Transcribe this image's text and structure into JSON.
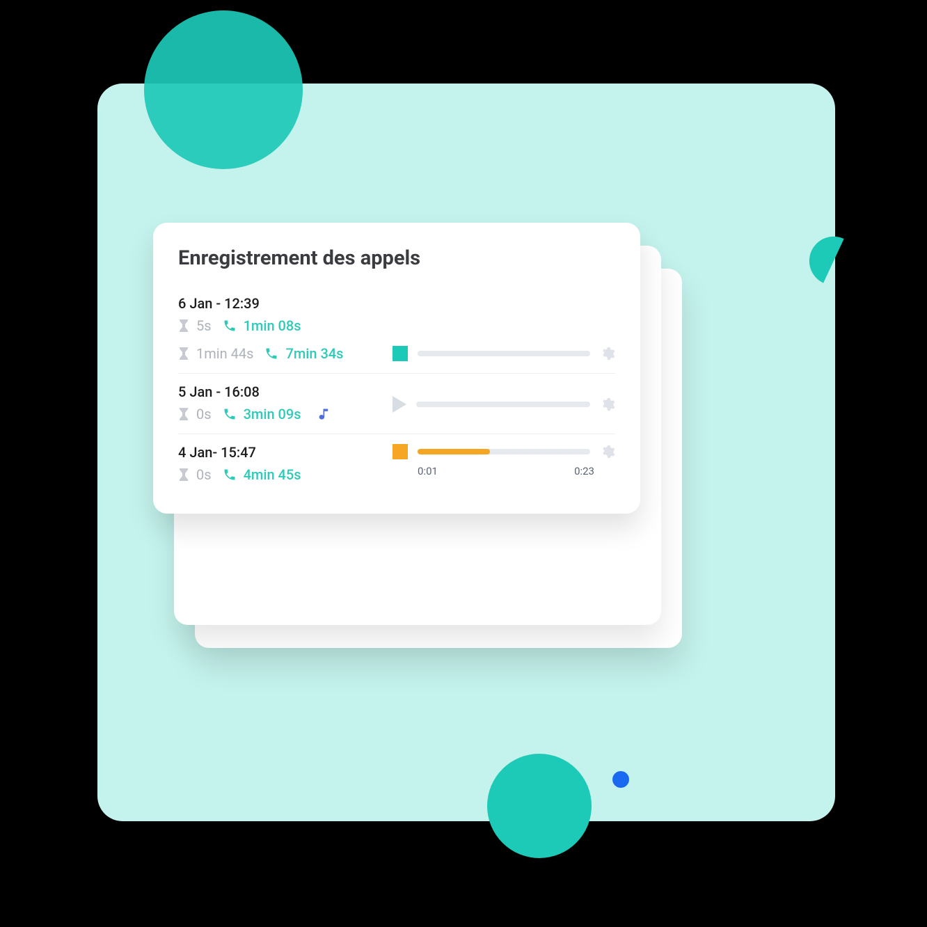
{
  "card": {
    "title": "Enregistrement des appels"
  },
  "entries": [
    {
      "date": "6 Jan - 12:39",
      "wait1": "5s",
      "duration1": "1min 08s",
      "wait2": "1min 44s",
      "duration2": "7min 34s",
      "player": {
        "state": "stop",
        "color": "teal",
        "progress": 0
      }
    },
    {
      "date": "5 Jan - 16:08",
      "wait": "0s",
      "duration": "3min 09s",
      "has_music_icon": true,
      "player": {
        "state": "play",
        "progress": 0
      }
    },
    {
      "date": "4 Jan- 15:47",
      "wait": "0s",
      "duration": "4min 45s",
      "player": {
        "state": "stop",
        "color": "orange",
        "progress": 42,
        "elapsed": "0:01",
        "total": "0:23"
      }
    }
  ],
  "colors": {
    "teal": "#1dc9b7",
    "orange": "#f5a623",
    "bg_mint": "#c4f2ec",
    "blue": "#1b69f0"
  }
}
